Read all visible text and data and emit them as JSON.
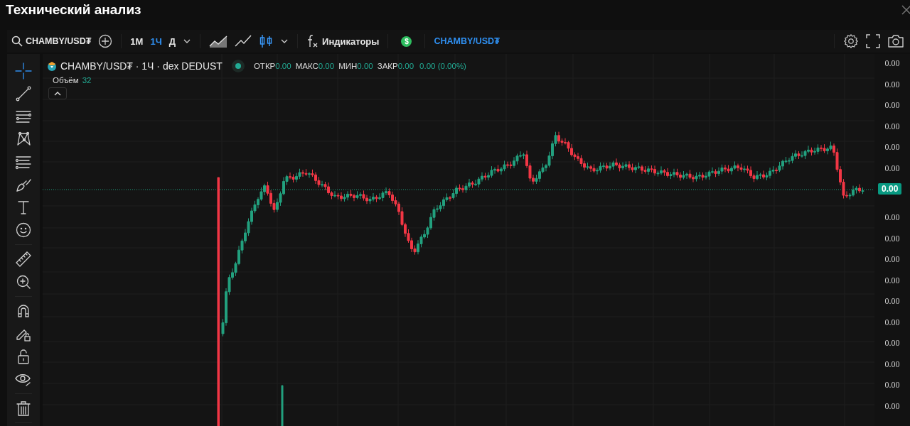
{
  "window": {
    "title": "Технический анализ"
  },
  "toolbar": {
    "symbol": "CHAMBY/USD₮",
    "timeframes": [
      {
        "label": "1М",
        "selected": false
      },
      {
        "label": "1Ч",
        "selected": true
      },
      {
        "label": "Д",
        "selected": false
      }
    ],
    "chart_types": [
      {
        "kind": "area",
        "selected": false
      },
      {
        "kind": "line",
        "selected": false
      },
      {
        "kind": "candles",
        "selected": true
      }
    ],
    "indicators_label": "Индикаторы",
    "currency_symbol": "$",
    "compare_symbol": "CHAMBY/USD₮"
  },
  "tool_groups": [
    {
      "tools": [
        {
          "kind": "crosshair",
          "selected": true
        },
        {
          "kind": "trend-line",
          "selected": false
        },
        {
          "kind": "horizontal-lines",
          "selected": false
        },
        {
          "kind": "pattern",
          "selected": false
        },
        {
          "kind": "fib",
          "selected": false
        },
        {
          "kind": "brush",
          "selected": false
        },
        {
          "kind": "text",
          "selected": false
        },
        {
          "kind": "emoji",
          "selected": false
        }
      ]
    },
    {
      "tools": [
        {
          "kind": "ruler",
          "selected": false
        },
        {
          "kind": "zoom",
          "selected": false
        }
      ]
    },
    {
      "tools": [
        {
          "kind": "magnet",
          "selected": false
        },
        {
          "kind": "lock-drawing",
          "selected": false
        },
        {
          "kind": "lock",
          "selected": false
        },
        {
          "kind": "hide",
          "selected": false
        }
      ]
    },
    {
      "tools": [
        {
          "kind": "trash",
          "selected": false
        }
      ]
    }
  ],
  "legend": {
    "title": "CHAMBY/USD₮ · 1Ч · dex DEDUST",
    "market_open": true,
    "ohlc": [
      {
        "label": "ОТКР",
        "value": "0.00"
      },
      {
        "label": "МАКС",
        "value": "0.00"
      },
      {
        "label": "МИН",
        "value": "0.00"
      },
      {
        "label": "ЗАКР",
        "value": "0.00"
      }
    ],
    "change": "0.00 (0.00%)",
    "volume_label": "Объём",
    "volume_value": "32"
  },
  "price_axis": {
    "labels": [
      "0.00",
      "0.00",
      "0.00",
      "0.00",
      "0.00",
      "0.00",
      "0.00",
      "0.00",
      "0.00",
      "0.00",
      "0.00",
      "0.00",
      "0.00",
      "0.00",
      "0.00",
      "0.00"
    ],
    "current_price": "0.00"
  }
}
